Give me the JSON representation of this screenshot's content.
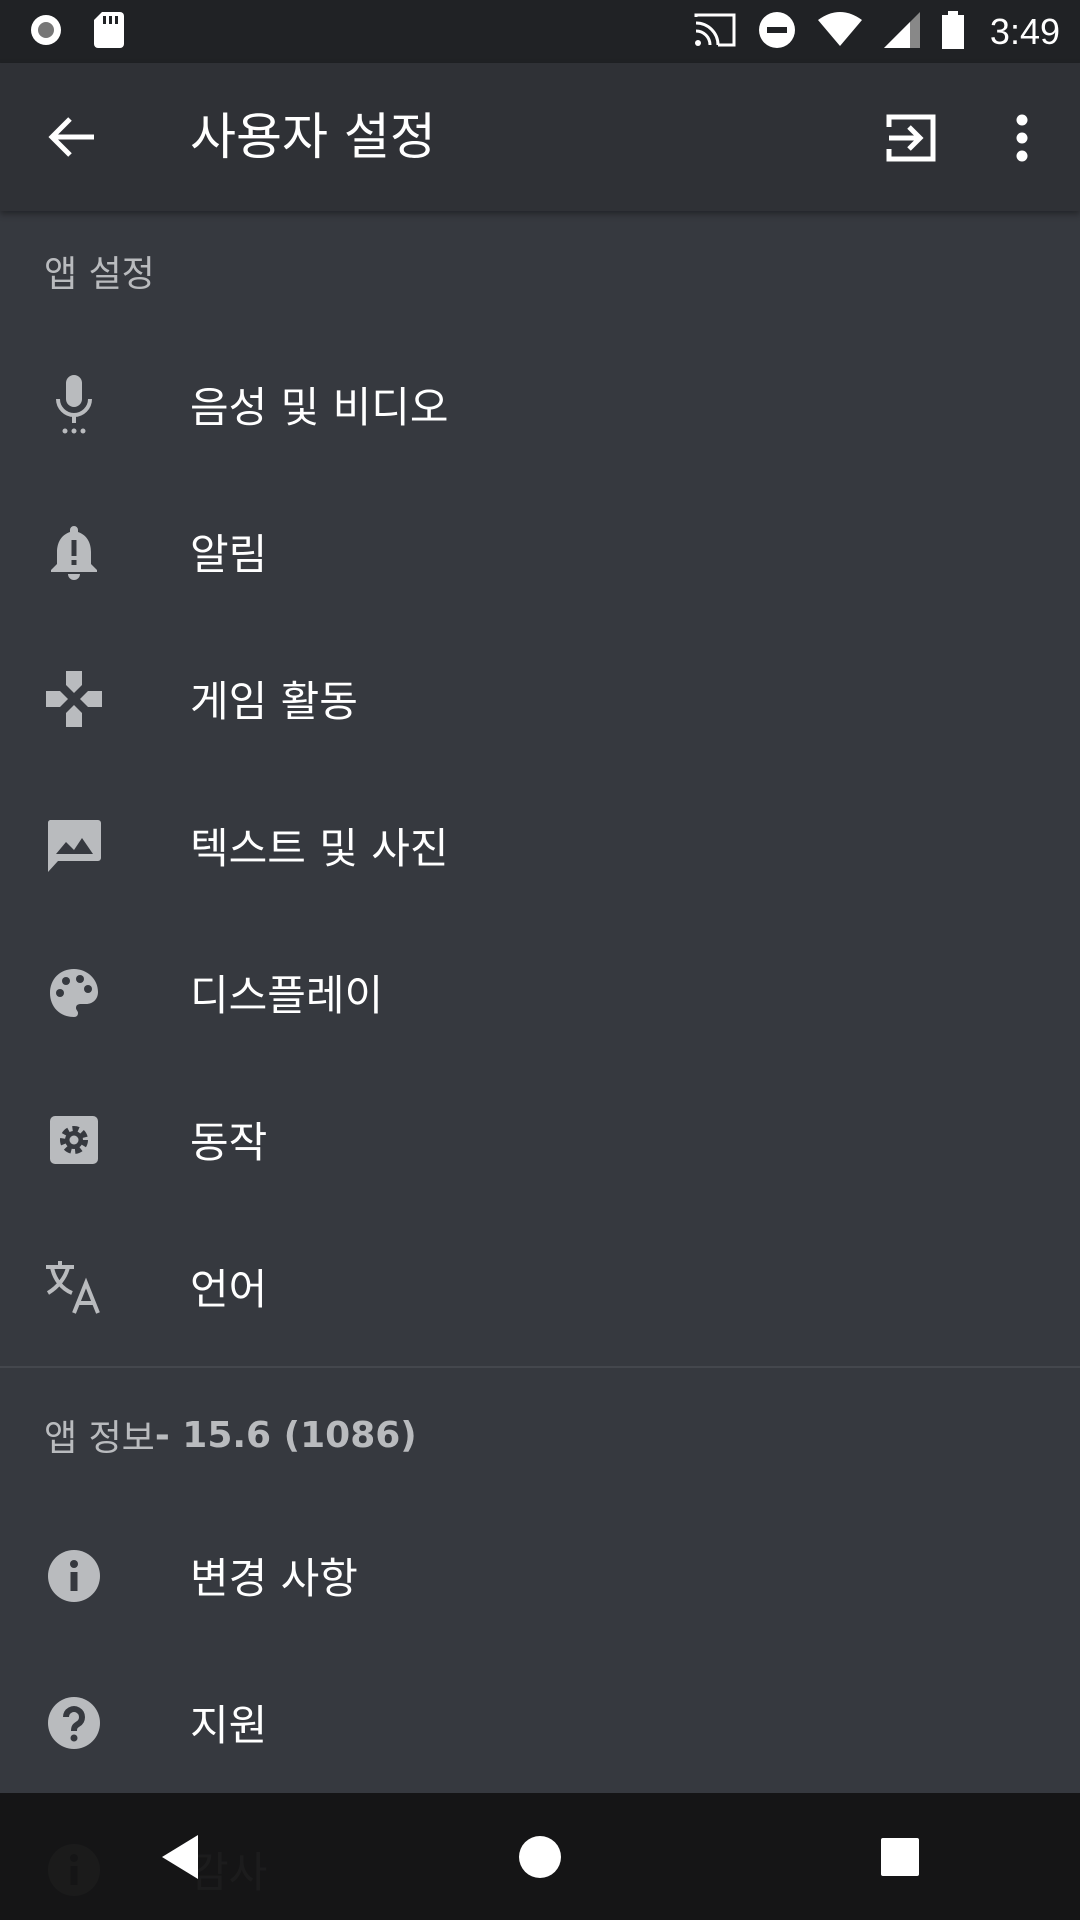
{
  "status_bar": {
    "time": "3:49",
    "icons": [
      "record-icon",
      "sd-card-icon",
      "cast-icon",
      "dnd-icon",
      "wifi-icon",
      "signal-icon",
      "battery-icon"
    ]
  },
  "app_bar": {
    "title": "사용자 설정",
    "back_icon": "arrow-left-icon",
    "logout_icon": "logout-icon",
    "more_icon": "more-vert-icon"
  },
  "sections": {
    "app_settings": {
      "header": "앱 설정",
      "items": [
        {
          "label": "음성 및 비디오",
          "icon": "microphone-icon"
        },
        {
          "label": "알림",
          "icon": "bell-icon"
        },
        {
          "label": "게임 활동",
          "icon": "gamepad-icon"
        },
        {
          "label": "텍스트 및 사진",
          "icon": "image-message-icon"
        },
        {
          "label": "디스플레이",
          "icon": "palette-icon"
        },
        {
          "label": "동작",
          "icon": "gear-icon"
        },
        {
          "label": "언어",
          "icon": "translate-icon"
        }
      ]
    },
    "app_info": {
      "header_prefix": "앱 정보",
      "header_version": " - 15.6 (1086)",
      "items": [
        {
          "label": "변경 사항",
          "icon": "info-icon"
        },
        {
          "label": "지원",
          "icon": "help-icon"
        },
        {
          "label": "감사",
          "icon": "info-icon"
        }
      ]
    }
  },
  "colors": {
    "background": "#36393f",
    "app_bar": "#2f3136",
    "status_bar": "#202225",
    "header_text": "#b9bbbe",
    "icon": "#b9bbbe"
  },
  "nav_bar": {
    "icons": [
      "back-triangle-icon",
      "home-circle-icon",
      "recents-square-icon"
    ]
  }
}
